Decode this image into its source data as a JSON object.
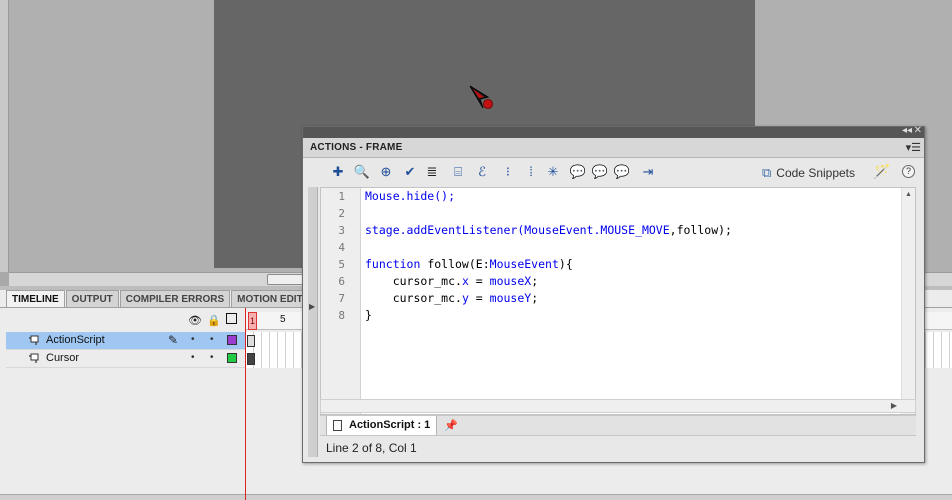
{
  "timeline": {
    "tabs": [
      "TIMELINE",
      "OUTPUT",
      "COMPILER ERRORS",
      "MOTION EDITO"
    ],
    "current_frame": "1",
    "frame_marker": "5",
    "layers": [
      {
        "name": "ActionScript",
        "swatch": "#9b3ccf",
        "selected": true
      },
      {
        "name": "Cursor",
        "swatch": "#22cc44",
        "selected": false
      }
    ]
  },
  "actions_panel": {
    "title": "ACTIONS - FRAME",
    "code_snippets_label": "Code Snippets",
    "line_numbers": [
      "1",
      "2",
      "3",
      "4",
      "5",
      "6",
      "7",
      "8"
    ],
    "code": {
      "l1": "Mouse.hide();",
      "l3a": "stage.addEventListener(",
      "l3b": "MouseEvent.MOUSE_MOVE",
      "l3c": ",follow);",
      "l5a": "function",
      "l5b": " follow(E:",
      "l5c": "MouseEvent",
      "l5d": "){",
      "l6a": "    cursor_mc.",
      "l6b": "x",
      "l6c": " = ",
      "l6d": "mouseX",
      "l6e": ";",
      "l7a": "    cursor_mc.",
      "l7b": "y",
      "l7c": " = ",
      "l7d": "mouseY",
      "l7e": ";",
      "l8": "}"
    },
    "script_tab_label": "ActionScript : 1",
    "status": "Line 2 of 8, Col 1"
  },
  "colors": {
    "stage": "#666666",
    "keyword": "#0000ee",
    "selected_layer": "#9fc7f2",
    "playhead": "#dd2222"
  }
}
